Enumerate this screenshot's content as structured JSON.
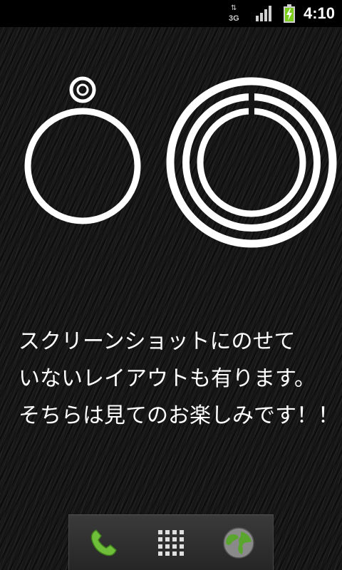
{
  "status_bar": {
    "network_label": "3G",
    "time": "4:10",
    "icons": [
      "data-activity-icon",
      "signal-strength-icon",
      "battery-charging-icon"
    ]
  },
  "home": {
    "message_lines": [
      "スクリーンショットにのせて",
      "いないレイアウトも有ります。",
      "そちらは見てのお楽しみです！！"
    ]
  },
  "dock": {
    "items": [
      {
        "name": "phone-icon",
        "color": "#6fbf3a"
      },
      {
        "name": "app-drawer-icon",
        "color": "#e0e0e0"
      },
      {
        "name": "browser-globe-icon",
        "color": "#5aa52e"
      }
    ]
  },
  "colors": {
    "status_bar_bg": "#000000",
    "battery_fill": "#7ccc1e",
    "ring": "#ffffff",
    "wallpaper": "#161616"
  }
}
